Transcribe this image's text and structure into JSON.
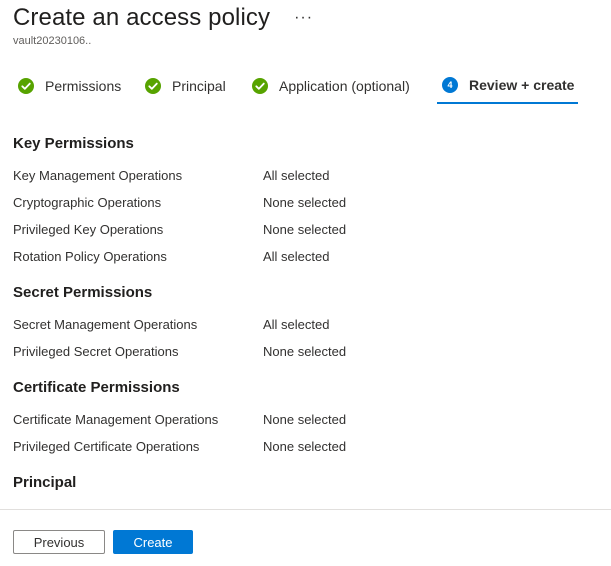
{
  "header": {
    "title": "Create an access policy",
    "more": "···",
    "subtitle": "vault20230106.."
  },
  "steps": [
    {
      "label": "Permissions",
      "status": "complete"
    },
    {
      "label": "Principal",
      "status": "complete"
    },
    {
      "label": "Application (optional)",
      "status": "complete"
    },
    {
      "label": "Review + create",
      "status": "active",
      "number": "4"
    }
  ],
  "sections": {
    "key": {
      "heading": "Key Permissions",
      "rows": [
        {
          "name": "Key Management Operations",
          "value": "All selected"
        },
        {
          "name": "Cryptographic Operations",
          "value": "None selected"
        },
        {
          "name": "Privileged Key Operations",
          "value": "None selected"
        },
        {
          "name": "Rotation Policy Operations",
          "value": "All selected"
        }
      ]
    },
    "secret": {
      "heading": "Secret Permissions",
      "rows": [
        {
          "name": "Secret Management Operations",
          "value": "All selected"
        },
        {
          "name": "Privileged Secret Operations",
          "value": "None selected"
        }
      ]
    },
    "certificate": {
      "heading": "Certificate Permissions",
      "rows": [
        {
          "name": "Certificate Management Operations",
          "value": "None selected"
        },
        {
          "name": "Privileged Certificate Operations",
          "value": "None selected"
        }
      ]
    },
    "principal": {
      "heading": "Principal"
    }
  },
  "footer": {
    "previous_label": "Previous",
    "create_label": "Create"
  },
  "colors": {
    "accent": "#0078d4",
    "success": "#57a300"
  }
}
